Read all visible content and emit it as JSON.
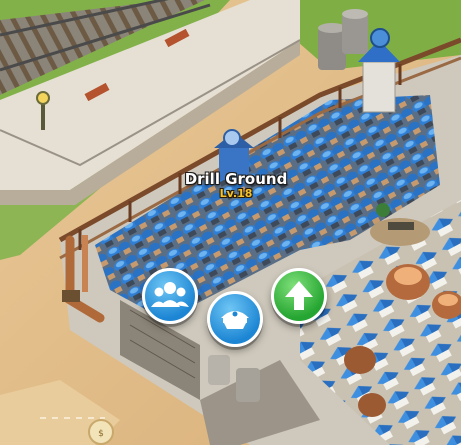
{
  "building": {
    "name": "Drill Ground",
    "level": "Lv.18"
  },
  "actions": [
    {
      "name": "troops",
      "icon": "soldiers-group-icon"
    },
    {
      "name": "officer",
      "icon": "officer-cap-icon"
    },
    {
      "name": "upgrade",
      "icon": "up-arrow-icon"
    }
  ],
  "colors": {
    "grass": "#7fae45",
    "dirt": "#e3c08f",
    "plaza": "#d7d3cb",
    "soldier_helmet": "#2f7fd6",
    "action_blue": "#1d86d4",
    "action_green": "#25a531",
    "level_text": "#f4c430"
  }
}
